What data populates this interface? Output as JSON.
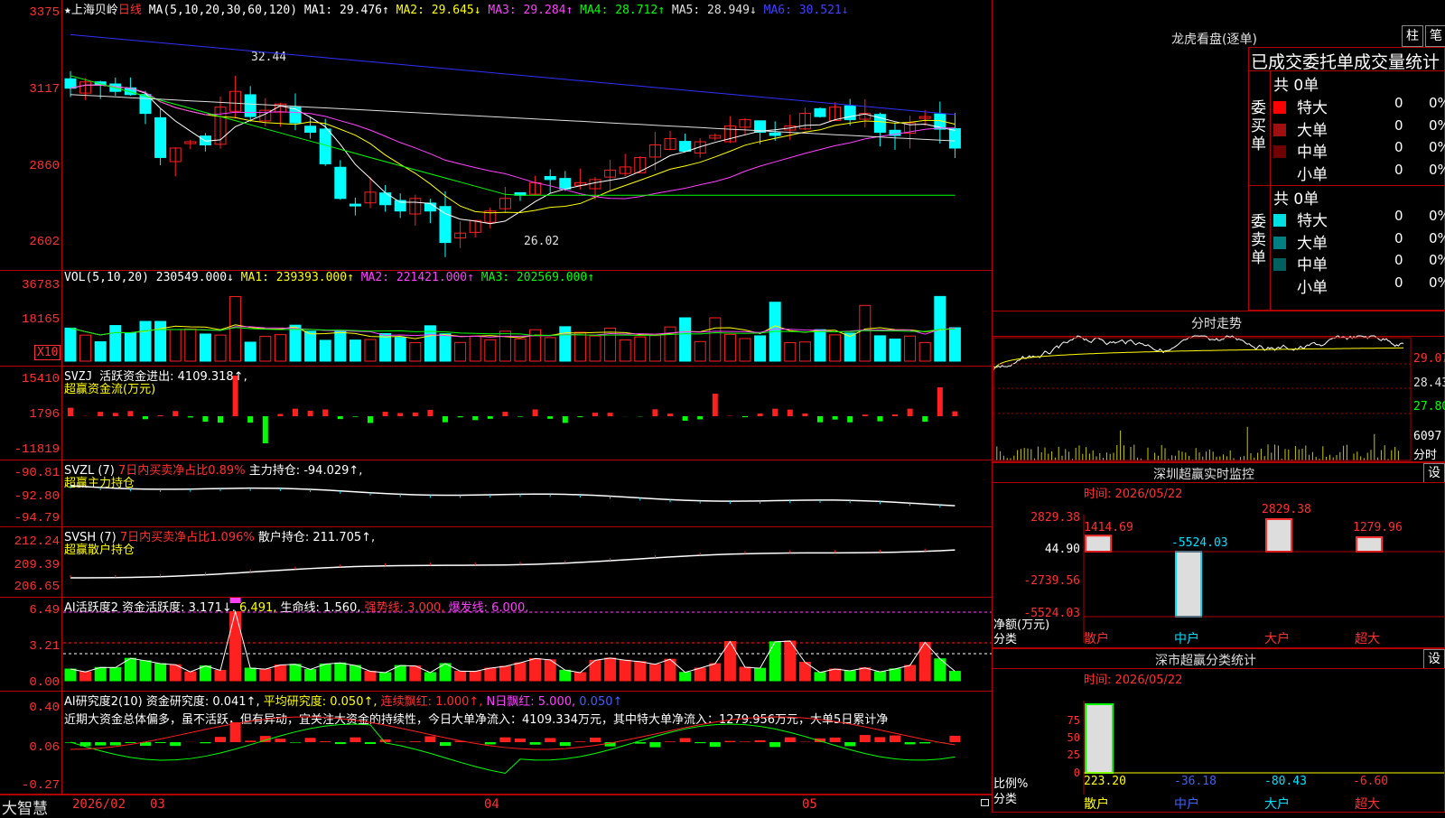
{
  "chart_data": [
    {
      "type": "line",
      "title": "上海贝岭",
      "period": "日线",
      "ylim": [
        2550,
        3400
      ],
      "yticks": [
        "3375",
        "3117",
        "2860",
        "2602"
      ],
      "annotations": [
        "32.44",
        "26.02"
      ],
      "ma_legend": [
        {
          "name": "MA1",
          "value": "29.476"
        },
        {
          "name": "MA2",
          "value": "29.645"
        },
        {
          "name": "MA3",
          "value": "29.284"
        },
        {
          "name": "MA4",
          "value": "28.712"
        },
        {
          "name": "MA5",
          "value": "28.949"
        },
        {
          "name": "MA6",
          "value": "30.521"
        }
      ],
      "x_ticks": [
        "2026/02",
        "03",
        "04",
        "05"
      ]
    },
    {
      "type": "bar",
      "title": "VOL(5,10,20)",
      "yticks": [
        "36783",
        "18165",
        "X10"
      ],
      "legend": [
        {
          "name": "",
          "value": "230549.000"
        },
        {
          "name": "MA1",
          "value": "239393.000"
        },
        {
          "name": "MA2",
          "value": "221421.000"
        },
        {
          "name": "MA3",
          "value": "202569.000"
        }
      ]
    },
    {
      "type": "bar",
      "title": "SVZJ",
      "yticks": [
        "15410",
        "1796",
        "-11819"
      ],
      "legend_text": "活跃资金进出: 4109.318",
      "sub": "超赢资金流(万元)"
    },
    {
      "type": "line",
      "title": "SVZL (7)",
      "yticks": [
        "-90.81",
        "-92.80",
        "-94.79"
      ],
      "legend_a": "7日内买卖净占比0.89%",
      "legend_b": "主力持仓: -94.029",
      "sub": "超赢主力持仓"
    },
    {
      "type": "line",
      "title": "SVSH (7)",
      "yticks": [
        "212.24",
        "209.39",
        "206.65"
      ],
      "legend_a": "7日内买卖净占比1.096%",
      "legend_b": "散户持仓: 211.705",
      "sub": "超赢散户持仓"
    },
    {
      "type": "bar",
      "title": "AI活跃度2",
      "yticks": [
        "6.49",
        "3.21",
        "0.00"
      ],
      "legend_a": "资金活跃度: 3.171",
      "legend_b": "6.491",
      "legend_c": "生命线: 1.560",
      "legend_d": "强势线: 3.000",
      "legend_e": "爆发线: 6.000"
    },
    {
      "type": "bar",
      "title": "AI研究度2(10)",
      "yticks": [
        "0.40",
        "0.06",
        "-0.27"
      ],
      "legend_a": "资金研究度: 0.041",
      "legend_b": "平均研究度: 0.050",
      "legend_c": "连续飘红: 1.000",
      "legend_d": "N日飘红: 5.000, 0.050"
    },
    {
      "type": "bar",
      "title": "深圳超赢实时监控",
      "categories": [
        "散户",
        "中户",
        "大户",
        "超大"
      ],
      "values": [
        1414.69,
        -5524.03,
        2829.38,
        1279.96
      ],
      "yticks": [
        "2829.38",
        "44.90",
        "-2739.56",
        "-5524.03"
      ],
      "ylabel": "净额(万元)",
      "xlabel": "分类"
    },
    {
      "type": "bar",
      "title": "深市超赢分类统计",
      "categories": [
        "散户",
        "中户",
        "大户",
        "超大"
      ],
      "values": [
        223.2,
        -36.18,
        -80.43,
        -6.6
      ],
      "yticks": [
        "75",
        "50",
        "25",
        "0"
      ],
      "ylabel": "比例%",
      "xlabel": "分类"
    }
  ],
  "header": {
    "star": "★",
    "stock": "上海贝岭",
    "period": "日线",
    "ma": "MA(5,10,20,30,60,120)",
    "ma1": "MA1: 29.476↑",
    "ma2": "MA2: 29.645↓",
    "ma3": "MA3: 29.284↑",
    "ma4": "MA4: 28.712↑",
    "ma5": "MA5: 28.949↓",
    "ma6": "MA6: 30.521↓"
  },
  "vol": {
    "title": "VOL(5,10,20)",
    "v": "230549.000↓",
    "ma1": "MA1: 239393.000↑",
    "ma2": "MA2: 221421.000↑",
    "ma3": "MA3: 202569.000↑"
  },
  "svzj": {
    "title": "SVZJ",
    "legend": "活跃资金进出: 4109.318↑,",
    "sub": "超赢资金流(万元)"
  },
  "svzl": {
    "title": "SVZL (7)",
    "a": "7日内买卖净占比0.89%",
    "b": "主力持仓: -94.029↑,",
    "sub": "超赢主力持仓"
  },
  "svsh": {
    "title": "SVSH (7)",
    "a": "7日内买卖净占比1.096%",
    "b": "散户持仓: 211.705↑,",
    "sub": "超赢散户持仓"
  },
  "ai1": {
    "title": "AI活跃度2",
    "a": "资金活跃度: 3.171↓,",
    "b": "6.491,",
    "c": "生命线: 1.560,",
    "d": "强势线: 3.000,",
    "e": "爆发线: 6.000,"
  },
  "ai2": {
    "title": "AI研究度2(10)",
    "a": "资金研究度: 0.041↑,",
    "b": "平均研究度: 0.050↑,",
    "c": "连续飘红: 1.000↑,",
    "d": "N日飘红: 5.000,",
    "e": "0.050↑"
  },
  "ai2_text": "近期大资金总体偏多，虽不活跃，但有异动，宜关注大资金的持续性，今日大单净流入：4109.334万元，其中特大单净流入：1279.956万元，大单5日累计净",
  "bottom": {
    "brand": "大智慧",
    "d1": "2026/02",
    "d2": "03",
    "d3": "04",
    "d4": "05"
  },
  "price": {
    "hi": "32.44",
    "lo": "26.02",
    "y1": "3375",
    "y2": "3117",
    "y3": "2860",
    "y4": "2602"
  },
  "vol_axis": {
    "y1": "36783",
    "y2": "18165",
    "y3": "X10"
  },
  "svzj_axis": {
    "y1": "15410",
    "y2": "1796",
    "y3": "-11819"
  },
  "svzl_axis": {
    "y1": "-90.81",
    "y2": "-92.80",
    "y3": "-94.79"
  },
  "svsh_axis": {
    "y1": "212.24",
    "y2": "209.39",
    "y3": "206.65"
  },
  "ai1_axis": {
    "y1": "6.49",
    "y2": "3.21",
    "y3": "0.00"
  },
  "ai2_axis": {
    "y1": "0.40",
    "y2": "0.06",
    "y3": "-0.27"
  },
  "right": {
    "lhb_title": "龙虎看盘(逐单)",
    "btn_zhu": "柱",
    "btn_bi": "笔",
    "stat_title": "已成交委托单成交量统计",
    "buy_label": "委买单",
    "sell_label": "委卖单",
    "buy_total": "共 0单",
    "sell_total": "共 0单",
    "rows_buy": [
      {
        "name": "特大",
        "v": "0",
        "p": "0%",
        "color": "#ff0000"
      },
      {
        "name": "大单",
        "v": "0",
        "p": "0%",
        "color": "#a01010"
      },
      {
        "name": "中单",
        "v": "0",
        "p": "0%",
        "color": "#700000"
      },
      {
        "name": "小单",
        "v": "0",
        "p": "0%",
        "color": "#000000"
      }
    ],
    "rows_sell": [
      {
        "name": "特大",
        "v": "0",
        "p": "0%",
        "color": "#00e0e0"
      },
      {
        "name": "大单",
        "v": "0",
        "p": "0%",
        "color": "#008080"
      },
      {
        "name": "中单",
        "v": "0",
        "p": "0%",
        "color": "#006060"
      },
      {
        "name": "小单",
        "v": "0",
        "p": "0%",
        "color": "#000000"
      }
    ],
    "fs_title": "分时走势",
    "fs_y1": "29.07",
    "fs_y2": "28.43",
    "fs_y3": "27.80",
    "fs_vol": "6097",
    "fs_unit": "分时",
    "sz_title": "深圳超赢实时监控",
    "sz_btn": "设",
    "sz_time": "时间: 2026/05/22",
    "sz_y1": "2829.38",
    "sz_y2": "44.90",
    "sz_y3": "-2739.56",
    "sz_y4": "-5524.03",
    "sz_v1": "1414.69",
    "sz_v2": "-5524.03",
    "sz_v3": "2829.38",
    "sz_v4": "1279.96",
    "sz_ylabel": "净额(万元)",
    "sz_xlabel": "分类",
    "cats": [
      "散户",
      "中户",
      "大户",
      "超大"
    ],
    "ss_title": "深市超赢分类统计",
    "ss_btn": "设",
    "ss_time": "时间: 2026/05/22",
    "ss_y1": "75",
    "ss_y2": "50",
    "ss_y3": "25",
    "ss_y4": "0",
    "ss_v1": "223.20",
    "ss_v2": "-36.18",
    "ss_v3": "-80.43",
    "ss_v4": "-6.60",
    "ss_ylabel": "比例%",
    "ss_xlabel": "分类"
  },
  "colors": {
    "up": "#ff2020",
    "down": "#00ffff",
    "grid": "#b00000"
  }
}
